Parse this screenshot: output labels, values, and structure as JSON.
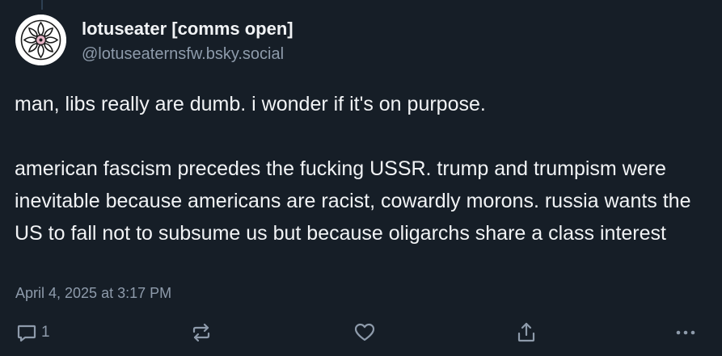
{
  "author": {
    "display_name": "lotuseater [comms open]",
    "handle": "@lotuseaternsfw.bsky.social"
  },
  "post": {
    "text": "man, libs really are dumb. i wonder if it's on purpose.\n\namerican fascism precedes the fucking USSR. trump and trumpism were inevitable because americans are racist, cowardly morons. russia wants the US to fall not to subsume us but because oligarchs share a class interest",
    "timestamp": "April 4, 2025 at 3:17 PM"
  },
  "actions": {
    "reply_count": "1",
    "icons": [
      "reply-icon",
      "repost-icon",
      "like-icon",
      "share-icon",
      "more-icon"
    ]
  },
  "colors": {
    "background": "#161e27",
    "text": "#f1f3f5",
    "muted": "#8e9bab"
  }
}
